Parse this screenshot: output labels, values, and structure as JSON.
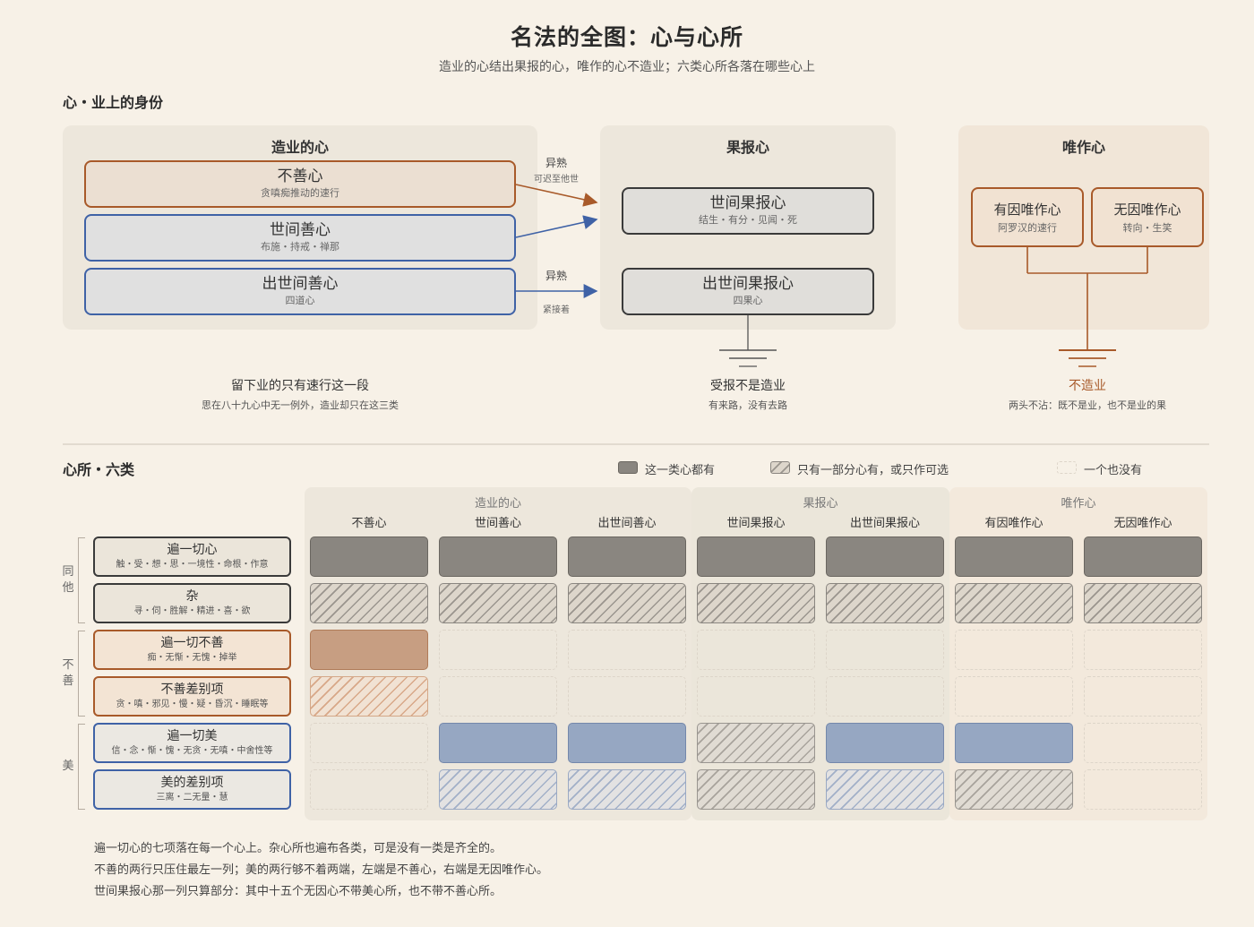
{
  "title": "名法的全图：心与心所",
  "subtitle": "造业的心结出果报的心，唯作的心不造业；六类心所各落在哪些心上",
  "section1": {
    "title": "心・业上的身份",
    "panels": {
      "karma": {
        "title": "造业的心",
        "boxes": [
          {
            "main": "不善心",
            "sub": "贪嗔痴推动的速行"
          },
          {
            "main": "世间善心",
            "sub": "布施・持戒・禅那"
          },
          {
            "main": "出世间善心",
            "sub": "四道心"
          }
        ]
      },
      "result": {
        "title": "果报心",
        "boxes": [
          {
            "main": "世间果报心",
            "sub": "结生・有分・见闻・死"
          },
          {
            "main": "出世间果报心",
            "sub": "四果心"
          }
        ]
      },
      "functional": {
        "title": "唯作心",
        "boxes": [
          {
            "main": "有因唯作心",
            "sub": "阿罗汉的速行"
          },
          {
            "main": "无因唯作心",
            "sub": "转向・生笑"
          }
        ]
      }
    },
    "arrows": {
      "top_label": "异熟",
      "top_sub": "可迟至他世",
      "bottom_label": "异熟",
      "bottom_sub": "紧接着"
    },
    "notes": [
      {
        "main": "留下业的只有速行这一段",
        "sub": "思在八十九心中无一例外，造业却只在这三类"
      },
      {
        "main": "受报不是造业",
        "sub": "有来路，没有去路"
      },
      {
        "main": "不造业",
        "sub": "两头不沾：既不是业，也不是业的果"
      }
    ],
    "colors": {
      "unwholesome": "#a85a2a",
      "wholesome": "#3f62a6",
      "result": "#3a3a3a"
    }
  },
  "section2": {
    "title": "心所・六类",
    "legend": [
      {
        "label": "这一类心都有"
      },
      {
        "label": "只有一部分心有，或只作可选"
      },
      {
        "label": "一个也没有"
      }
    ],
    "groups": [
      {
        "label": "造业的心",
        "columns": [
          "不善心",
          "世间善心",
          "出世间善心"
        ]
      },
      {
        "label": "果报心",
        "columns": [
          "世间果报心",
          "出世间果报心"
        ]
      },
      {
        "label": "唯作心",
        "columns": [
          "有因唯作心",
          "无因唯作心"
        ]
      }
    ],
    "side_groups": [
      {
        "label": "同他"
      },
      {
        "label": "不善"
      },
      {
        "label": "美"
      }
    ],
    "rows": [
      {
        "main": "遍一切心",
        "sub": "触・受・想・思・一境性・命根・作意",
        "cells": [
          "full-gray",
          "full-gray",
          "full-gray",
          "full-gray",
          "full-gray",
          "full-gray",
          "full-gray"
        ]
      },
      {
        "main": "杂",
        "sub": "寻・伺・胜解・精进・喜・欲",
        "cells": [
          "part-gray",
          "part-gray",
          "part-gray",
          "part-gray",
          "part-gray",
          "part-gray",
          "part-gray"
        ]
      },
      {
        "main": "遍一切不善",
        "sub": "痴・无惭・无愧・掉举",
        "cells": [
          "full-unw",
          "none",
          "none",
          "none",
          "none",
          "none",
          "none"
        ]
      },
      {
        "main": "不善差别项",
        "sub": "贪・嗔・邪见・慢・疑・昏沉・睡眠等",
        "cells": [
          "part-unw",
          "none",
          "none",
          "none",
          "none",
          "none",
          "none"
        ]
      },
      {
        "main": "遍一切美",
        "sub": "信・念・惭・愧・无贪・无嗔・中舍性等",
        "cells": [
          "none",
          "full-wh",
          "full-wh",
          "part-gw",
          "full-wh",
          "full-wh",
          "none"
        ]
      },
      {
        "main": "美的差别项",
        "sub": "三离・二无量・慧",
        "cells": [
          "none",
          "part-wh",
          "part-wh",
          "part-gw",
          "part-wh",
          "part-gw",
          "none"
        ]
      }
    ],
    "footnotes": [
      "遍一切心的七项落在每一个心上。杂心所也遍布各类，可是没有一类是齐全的。",
      "不善的两行只压住最左一列；美的两行够不着两端，左端是不善心，右端是无因唯作心。",
      "世间果报心那一列只算部分：其中十五个无因心不带美心所，也不带不善心所。"
    ]
  }
}
